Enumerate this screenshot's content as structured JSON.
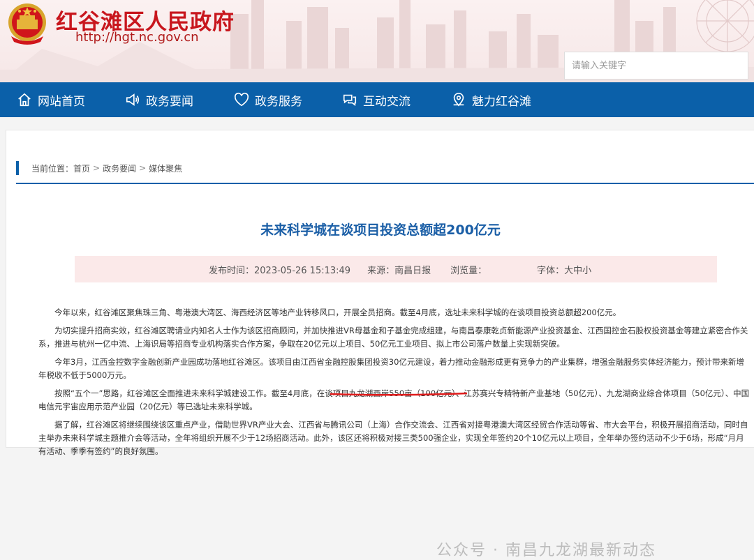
{
  "header": {
    "site_title": "红谷滩区人民政府",
    "site_url": "http://hgt.nc.gov.cn",
    "search_placeholder": "请输入关键字",
    "emblem_icon": "national-emblem-icon"
  },
  "nav": {
    "items": [
      {
        "label": "网站首页",
        "icon": "home-icon"
      },
      {
        "label": "政务要闻",
        "icon": "megaphone-icon"
      },
      {
        "label": "政务服务",
        "icon": "heart-shield-icon"
      },
      {
        "label": "互动交流",
        "icon": "chat-icon"
      },
      {
        "label": "魅力红谷滩",
        "icon": "location-icon"
      }
    ]
  },
  "breadcrumb": {
    "prefix": "当前位置：",
    "items": [
      "首页",
      "政务要闻",
      "媒体聚焦"
    ],
    "separator": ">"
  },
  "article": {
    "title": "未来科学城在谈项目投资总额超200亿元",
    "meta": {
      "publish_time": "发布时间：2023-05-26 15:13:49",
      "source": "来源：南昌日报",
      "views": "浏览量：",
      "font_size": "字体：大中小"
    },
    "paragraphs": [
      "今年以来，红谷滩区聚焦珠三角、粤港澳大湾区、海西经济区等地产业转移风口，开展全员招商。截至4月底，选址未来科学城的在谈项目投资总额超200亿元。",
      "为切实提升招商实效，红谷滩区聘请业内知名人士作为该区招商顾问，并加快推进VR母基金和子基金完成组建，与南昌泰康乾贞新能源产业投资基金、江西国控金石股权投资基金等建立紧密合作关系，推进与杭州一亿中流、上海识局等招商专业机构落实合作方案，争取在20亿元以上项目、50亿元工业项目、拟上市公司落户数量上实现新突破。",
      "今年3月，江西金控数字金融创新产业园成功落地红谷滩区。该项目由江西省金融控股集团投资30亿元建设，着力推动金融形成更有竞争力的产业集群，增强金融服务实体经济能力，预计带来新增年税收不低于5000万元。",
      {
        "before": "按照“五个一”思路，红谷滩区全面推进未来科学城建设工作。截至4月底，",
        "highlight": "在谈项目九龙湖西岸550亩（100亿元）",
        "after": "、江苏赛兴专精特新产业基地（50亿元）、九龙湖商业综合体项目（50亿元）、中国电信元宇宙应用示范产业园（20亿元）等已选址未来科学城。"
      },
      "据了解，红谷滩区将继续围绕该区重点产业，借助世界VR产业大会、江西省与腾讯公司（上海）合作交流会、江西省对接粤港澳大湾区经贸合作活动等省、市大会平台，积极开展招商活动，同时自主举办未来科学城主题推介会等活动，全年将组织开展不少于12场招商活动。此外，该区还将积极对接三类500强企业，实现全年签约20个10亿元以上项目，全年举办签约活动不少于6场，形成“月月有活动、季季有签约”的良好氛围。"
    ]
  },
  "watermark": "公众号 · 南昌九龙湖最新动态",
  "colors": {
    "nav_blue": "#0b60a9",
    "title_red": "#c8161d",
    "meta_bg": "#fbe9e9",
    "highlight_underline": "#e01b1b"
  }
}
